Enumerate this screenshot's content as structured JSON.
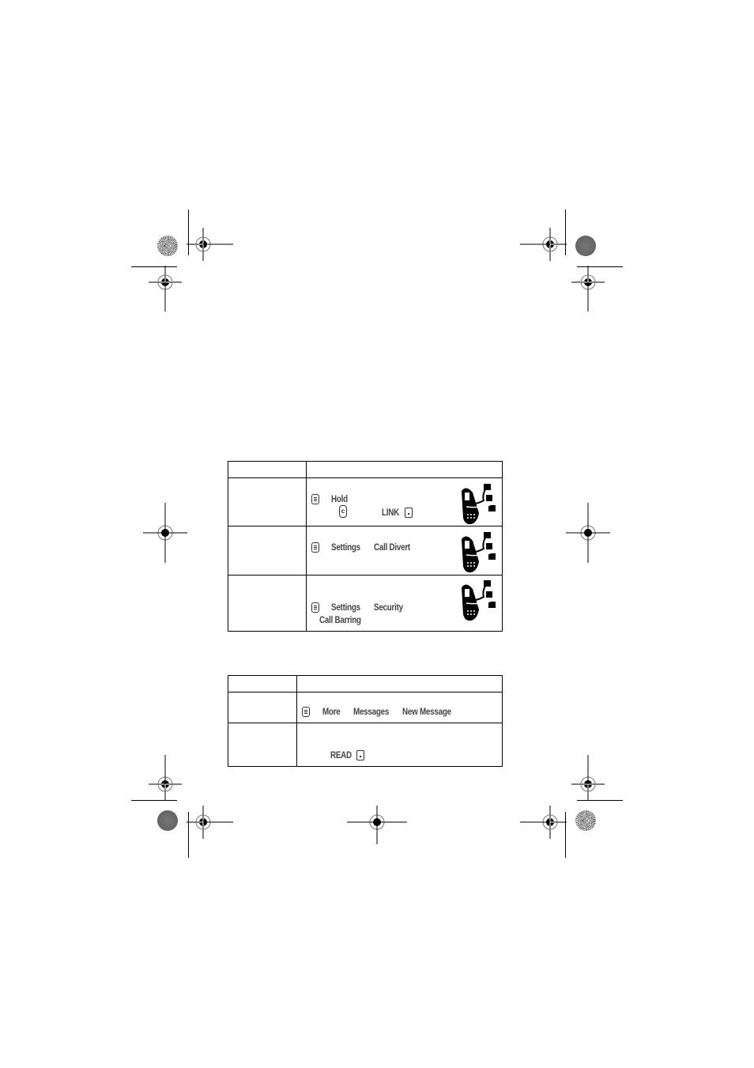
{
  "page": {
    "background": "#ffffff",
    "ink": "#000000"
  },
  "table1": {
    "rows": [
      {
        "feature": "",
        "description": ""
      },
      {
        "feature": "",
        "keys": [
          "Hold",
          "LINK"
        ],
        "icons": [
          "menu-key-icon",
          "clear-key-icon",
          "right-soft-key-icon",
          "network-feature-icon"
        ]
      },
      {
        "feature": "",
        "keys": [
          "Settings",
          "Call Divert"
        ],
        "icons": [
          "menu-key-icon",
          "network-feature-icon"
        ]
      },
      {
        "feature": "",
        "keys": [
          "Settings",
          "Security",
          "Call Barring"
        ],
        "icons": [
          "menu-key-icon",
          "network-feature-icon"
        ]
      }
    ]
  },
  "table2": {
    "rows": [
      {
        "feature": "",
        "description": ""
      },
      {
        "feature": "",
        "keys": [
          "More",
          "Messages",
          "New Message"
        ],
        "icons": [
          "menu-key-icon"
        ]
      },
      {
        "feature": "",
        "keys": [
          "READ"
        ],
        "icons": [
          "right-soft-key-icon"
        ]
      }
    ]
  }
}
